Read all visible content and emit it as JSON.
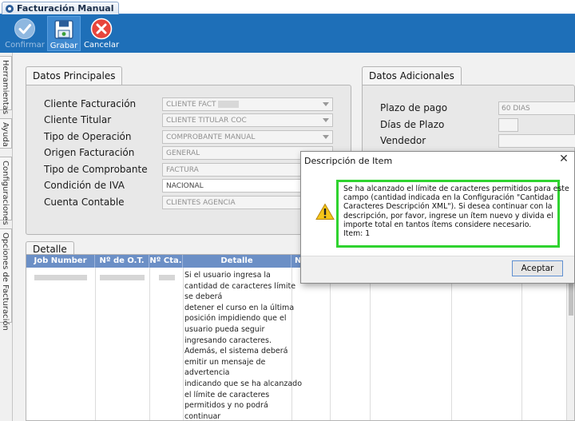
{
  "window": {
    "tab_title": "Facturación Manual"
  },
  "toolbar": {
    "confirm_label": "Confirmar",
    "save_label": "Grabar",
    "cancel_label": "Cancelar"
  },
  "sidebar": {
    "tabs": [
      "Herramientas",
      "Ayuda",
      "Configuraciones",
      "Opciones de Facturación"
    ]
  },
  "principal": {
    "title": "Datos Principales",
    "fields": [
      {
        "label": "Cliente Facturación",
        "value": "CLIENTE FACT"
      },
      {
        "label": "Cliente Titular",
        "value": "CLIENTE TITULAR COC"
      },
      {
        "label": "Tipo de Operación",
        "value": "COMPROBANTE MANUAL"
      },
      {
        "label": "Origen Facturación",
        "value": "GENERAL"
      },
      {
        "label": "Tipo de Comprobante",
        "value": "FACTURA"
      },
      {
        "label": "Condición de IVA",
        "value": "NACIONAL"
      },
      {
        "label": "Cuenta Contable",
        "value": "CLIENTES AGENCIA"
      }
    ]
  },
  "adicionales": {
    "title": "Datos Adicionales",
    "plazo_label": "Plazo de pago",
    "plazo_value": "60 DIAS",
    "dias_label": "Días de Plazo",
    "vendedor_label": "Vendedor"
  },
  "detalle": {
    "title": "Detalle",
    "columns": [
      "Job Number",
      "Nº de O.T.",
      "Nº Cta.",
      "Detalle",
      "N"
    ],
    "detail_lines": [
      "Si el usuario ingresa la",
      "cantidad de caracteres límite",
      "se deberá",
      "detener el curso en la última",
      "posición impidiendo que el",
      "usuario pueda seguir",
      "ingresando caracteres.",
      "Además, el sistema deberá",
      "emitir un mensaje de",
      "advertencia",
      "indicando que se ha alcanzado",
      "el límite de caracteres",
      "permitidos y no podrá",
      "continuar"
    ]
  },
  "dialog": {
    "title": "Descripción de Item",
    "close": "✕",
    "message_lines": [
      "Se ha alcanzado el límite de caracteres permitidos para este",
      "campo (cantidad indicada en la Configuración \"Cantidad",
      "Caracteres Descripción XML\"). Si desea continuar con la",
      "descripción, por favor, ingrese un ítem nuevo y divida el",
      "importe total en tantos ítems considere necesario.",
      "Item: 1"
    ],
    "ok_label": "Aceptar",
    "highlight_color": "#2fd32f"
  }
}
